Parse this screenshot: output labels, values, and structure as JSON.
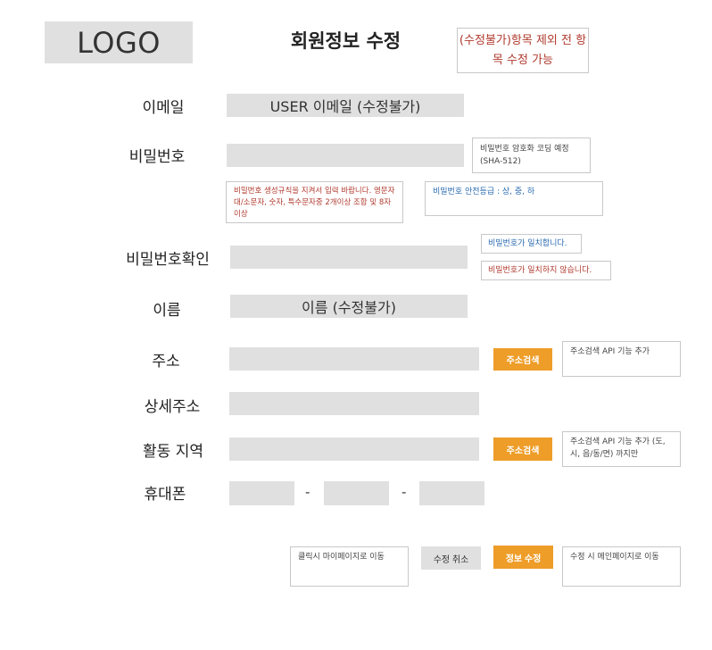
{
  "header": {
    "logo": "LOGO",
    "title": "회원정보 수정",
    "note": "(수정불가)항목 제외 전 항목 수정 가능"
  },
  "form": {
    "email": {
      "label": "이메일",
      "value": "USER 이메일 (수정불가)"
    },
    "password": {
      "label": "비밀번호",
      "note_hash": "비밀번호 암호화 코딩 예정 (SHA-512)",
      "note_rules": "비밀번호 생성규칙을 지켜서 입력 바랍니다. 영문자 대/소문자, 숫자, 특수문자중 2개이상 조합 및 8자 이상",
      "note_strength": "비밀번호 안전등급 : 상, 중, 하"
    },
    "password_confirm": {
      "label": "비밀번호확인",
      "note_match": "비밀번호가 일치합니다.",
      "note_mismatch": "비밀번호가 일치하지 않습니다."
    },
    "name": {
      "label": "이름",
      "value": "이름 (수정불가)"
    },
    "address": {
      "label": "주소",
      "button": "주소검색",
      "note": "주소검색 API 기능 추가"
    },
    "address_detail": {
      "label": "상세주소"
    },
    "region": {
      "label": "활동 지역",
      "button": "주소검색",
      "note": "주소검색 API 기능 추가 (도, 시, 읍/동/면) 까지만"
    },
    "phone": {
      "label": "휴대폰",
      "separator1": "-",
      "separator2": "-"
    }
  },
  "footer": {
    "cancel_note": "클릭시 마이페이지로 이동",
    "cancel_button": "수정 취소",
    "submit_button": "정보 수정",
    "submit_note": "수정 시 메인페이지로 이동"
  },
  "colors": {
    "accent": "#ee9d28",
    "field_bg": "#e0e0e0",
    "note_red": "#b03a2e",
    "note_blue": "#2a6bb0"
  }
}
